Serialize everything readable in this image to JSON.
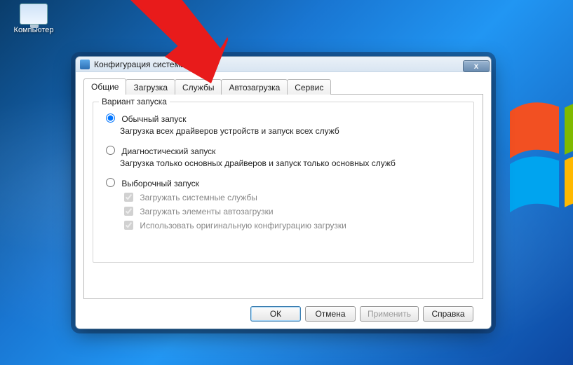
{
  "desktop": {
    "computer_label": "Компьютер"
  },
  "dialog": {
    "title": "Конфигурация системы",
    "close_glyph": "х",
    "tabs": [
      {
        "label": "Общие"
      },
      {
        "label": "Загрузка"
      },
      {
        "label": "Службы"
      },
      {
        "label": "Автозагрузка"
      },
      {
        "label": "Сервис"
      }
    ],
    "group": {
      "legend": "Вариант запуска",
      "opt1": {
        "label": "Обычный запуск",
        "desc": "Загрузка всех драйверов устройств и запуск всех служб"
      },
      "opt2": {
        "label": "Диагностический запуск",
        "desc": "Загрузка только основных драйверов и запуск только основных служб"
      },
      "opt3": {
        "label": "Выборочный запуск"
      },
      "chk1": "Загружать системные службы",
      "chk2": "Загружать элементы автозагрузки",
      "chk3": "Использовать оригинальную конфигурацию загрузки"
    },
    "buttons": {
      "ok": "ОК",
      "cancel": "Отмена",
      "apply": "Применить",
      "help": "Справка"
    }
  }
}
